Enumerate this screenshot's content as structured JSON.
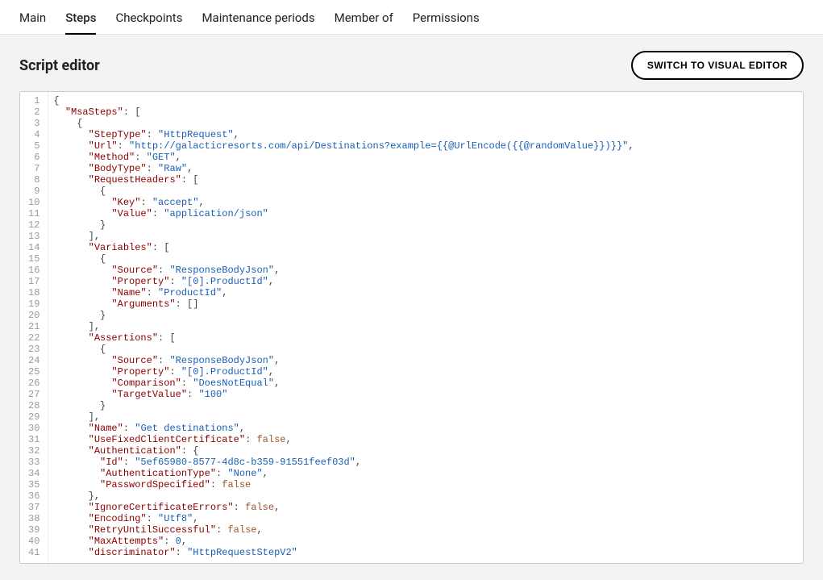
{
  "tabs": [
    {
      "label": "Main",
      "active": false
    },
    {
      "label": "Steps",
      "active": true
    },
    {
      "label": "Checkpoints",
      "active": false
    },
    {
      "label": "Maintenance periods",
      "active": false
    },
    {
      "label": "Member of",
      "active": false
    },
    {
      "label": "Permissions",
      "active": false
    }
  ],
  "editor_title": "Script editor",
  "switch_button_label": "SWITCH TO VISUAL EDITOR",
  "code_lines": [
    [
      [
        "p",
        "{"
      ]
    ],
    [
      [
        "p",
        "  "
      ],
      [
        "k",
        "\"MsaSteps\""
      ],
      [
        "p",
        ": ["
      ]
    ],
    [
      [
        "p",
        "    {"
      ]
    ],
    [
      [
        "p",
        "      "
      ],
      [
        "k",
        "\"StepType\""
      ],
      [
        "p",
        ": "
      ],
      [
        "s",
        "\"HttpRequest\""
      ],
      [
        "p",
        ","
      ]
    ],
    [
      [
        "p",
        "      "
      ],
      [
        "k",
        "\"Url\""
      ],
      [
        "p",
        ": "
      ],
      [
        "s",
        "\"http://galacticresorts.com/api/Destinations?example={{@UrlEncode({{@randomValue}})}}\""
      ],
      [
        "p",
        ","
      ]
    ],
    [
      [
        "p",
        "      "
      ],
      [
        "k",
        "\"Method\""
      ],
      [
        "p",
        ": "
      ],
      [
        "s",
        "\"GET\""
      ],
      [
        "p",
        ","
      ]
    ],
    [
      [
        "p",
        "      "
      ],
      [
        "k",
        "\"BodyType\""
      ],
      [
        "p",
        ": "
      ],
      [
        "s",
        "\"Raw\""
      ],
      [
        "p",
        ","
      ]
    ],
    [
      [
        "p",
        "      "
      ],
      [
        "k",
        "\"RequestHeaders\""
      ],
      [
        "p",
        ": ["
      ]
    ],
    [
      [
        "p",
        "        {"
      ]
    ],
    [
      [
        "p",
        "          "
      ],
      [
        "k",
        "\"Key\""
      ],
      [
        "p",
        ": "
      ],
      [
        "s",
        "\"accept\""
      ],
      [
        "p",
        ","
      ]
    ],
    [
      [
        "p",
        "          "
      ],
      [
        "k",
        "\"Value\""
      ],
      [
        "p",
        ": "
      ],
      [
        "s",
        "\"application/json\""
      ]
    ],
    [
      [
        "p",
        "        }"
      ]
    ],
    [
      [
        "p",
        "      ],"
      ]
    ],
    [
      [
        "p",
        "      "
      ],
      [
        "k",
        "\"Variables\""
      ],
      [
        "p",
        ": ["
      ]
    ],
    [
      [
        "p",
        "        {"
      ]
    ],
    [
      [
        "p",
        "          "
      ],
      [
        "k",
        "\"Source\""
      ],
      [
        "p",
        ": "
      ],
      [
        "s",
        "\"ResponseBodyJson\""
      ],
      [
        "p",
        ","
      ]
    ],
    [
      [
        "p",
        "          "
      ],
      [
        "k",
        "\"Property\""
      ],
      [
        "p",
        ": "
      ],
      [
        "s",
        "\"[0].ProductId\""
      ],
      [
        "p",
        ","
      ]
    ],
    [
      [
        "p",
        "          "
      ],
      [
        "k",
        "\"Name\""
      ],
      [
        "p",
        ": "
      ],
      [
        "s",
        "\"ProductId\""
      ],
      [
        "p",
        ","
      ]
    ],
    [
      [
        "p",
        "          "
      ],
      [
        "k",
        "\"Arguments\""
      ],
      [
        "p",
        ": []"
      ]
    ],
    [
      [
        "p",
        "        }"
      ]
    ],
    [
      [
        "p",
        "      ],"
      ]
    ],
    [
      [
        "p",
        "      "
      ],
      [
        "k",
        "\"Assertions\""
      ],
      [
        "p",
        ": ["
      ]
    ],
    [
      [
        "p",
        "        {"
      ]
    ],
    [
      [
        "p",
        "          "
      ],
      [
        "k",
        "\"Source\""
      ],
      [
        "p",
        ": "
      ],
      [
        "s",
        "\"ResponseBodyJson\""
      ],
      [
        "p",
        ","
      ]
    ],
    [
      [
        "p",
        "          "
      ],
      [
        "k",
        "\"Property\""
      ],
      [
        "p",
        ": "
      ],
      [
        "s",
        "\"[0].ProductId\""
      ],
      [
        "p",
        ","
      ]
    ],
    [
      [
        "p",
        "          "
      ],
      [
        "k",
        "\"Comparison\""
      ],
      [
        "p",
        ": "
      ],
      [
        "s",
        "\"DoesNotEqual\""
      ],
      [
        "p",
        ","
      ]
    ],
    [
      [
        "p",
        "          "
      ],
      [
        "k",
        "\"TargetValue\""
      ],
      [
        "p",
        ": "
      ],
      [
        "s",
        "\"100\""
      ]
    ],
    [
      [
        "p",
        "        }"
      ]
    ],
    [
      [
        "p",
        "      ],"
      ]
    ],
    [
      [
        "p",
        "      "
      ],
      [
        "k",
        "\"Name\""
      ],
      [
        "p",
        ": "
      ],
      [
        "s",
        "\"Get destinations\""
      ],
      [
        "p",
        ","
      ]
    ],
    [
      [
        "p",
        "      "
      ],
      [
        "k",
        "\"UseFixedClientCertificate\""
      ],
      [
        "p",
        ": "
      ],
      [
        "b",
        "false"
      ],
      [
        "p",
        ","
      ]
    ],
    [
      [
        "p",
        "      "
      ],
      [
        "k",
        "\"Authentication\""
      ],
      [
        "p",
        ": {"
      ]
    ],
    [
      [
        "p",
        "        "
      ],
      [
        "k",
        "\"Id\""
      ],
      [
        "p",
        ": "
      ],
      [
        "s",
        "\"5ef65980-8577-4d8c-b359-91551feef03d\""
      ],
      [
        "p",
        ","
      ]
    ],
    [
      [
        "p",
        "        "
      ],
      [
        "k",
        "\"AuthenticationType\""
      ],
      [
        "p",
        ": "
      ],
      [
        "s",
        "\"None\""
      ],
      [
        "p",
        ","
      ]
    ],
    [
      [
        "p",
        "        "
      ],
      [
        "k",
        "\"PasswordSpecified\""
      ],
      [
        "p",
        ": "
      ],
      [
        "b",
        "false"
      ]
    ],
    [
      [
        "p",
        "      },"
      ]
    ],
    [
      [
        "p",
        "      "
      ],
      [
        "k",
        "\"IgnoreCertificateErrors\""
      ],
      [
        "p",
        ": "
      ],
      [
        "b",
        "false"
      ],
      [
        "p",
        ","
      ]
    ],
    [
      [
        "p",
        "      "
      ],
      [
        "k",
        "\"Encoding\""
      ],
      [
        "p",
        ": "
      ],
      [
        "s",
        "\"Utf8\""
      ],
      [
        "p",
        ","
      ]
    ],
    [
      [
        "p",
        "      "
      ],
      [
        "k",
        "\"RetryUntilSuccessful\""
      ],
      [
        "p",
        ": "
      ],
      [
        "b",
        "false"
      ],
      [
        "p",
        ","
      ]
    ],
    [
      [
        "p",
        "      "
      ],
      [
        "k",
        "\"MaxAttempts\""
      ],
      [
        "p",
        ": "
      ],
      [
        "n",
        "0"
      ],
      [
        "p",
        ","
      ]
    ],
    [
      [
        "p",
        "      "
      ],
      [
        "k",
        "\"discriminator\""
      ],
      [
        "p",
        ": "
      ],
      [
        "s",
        "\"HttpRequestStepV2\""
      ]
    ]
  ]
}
